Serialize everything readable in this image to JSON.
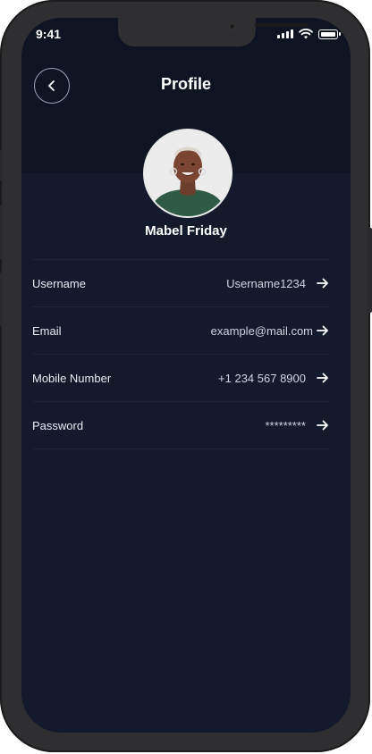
{
  "status_bar": {
    "time": "9:41"
  },
  "header": {
    "title": "Profile",
    "back_icon": "chevron-left-icon"
  },
  "profile": {
    "name": "Mabel Friday"
  },
  "rows": [
    {
      "label": "Username",
      "value": "Username1234"
    },
    {
      "label": "Email",
      "value": "example@mail.com"
    },
    {
      "label": "Mobile Number",
      "value": "+1 234 567 8900"
    },
    {
      "label": "Password",
      "value": "*********"
    }
  ],
  "theme": {
    "background": "#121a2b",
    "header_background": "#0f1422",
    "text": "#ffffff",
    "divider": "#1d2638"
  }
}
